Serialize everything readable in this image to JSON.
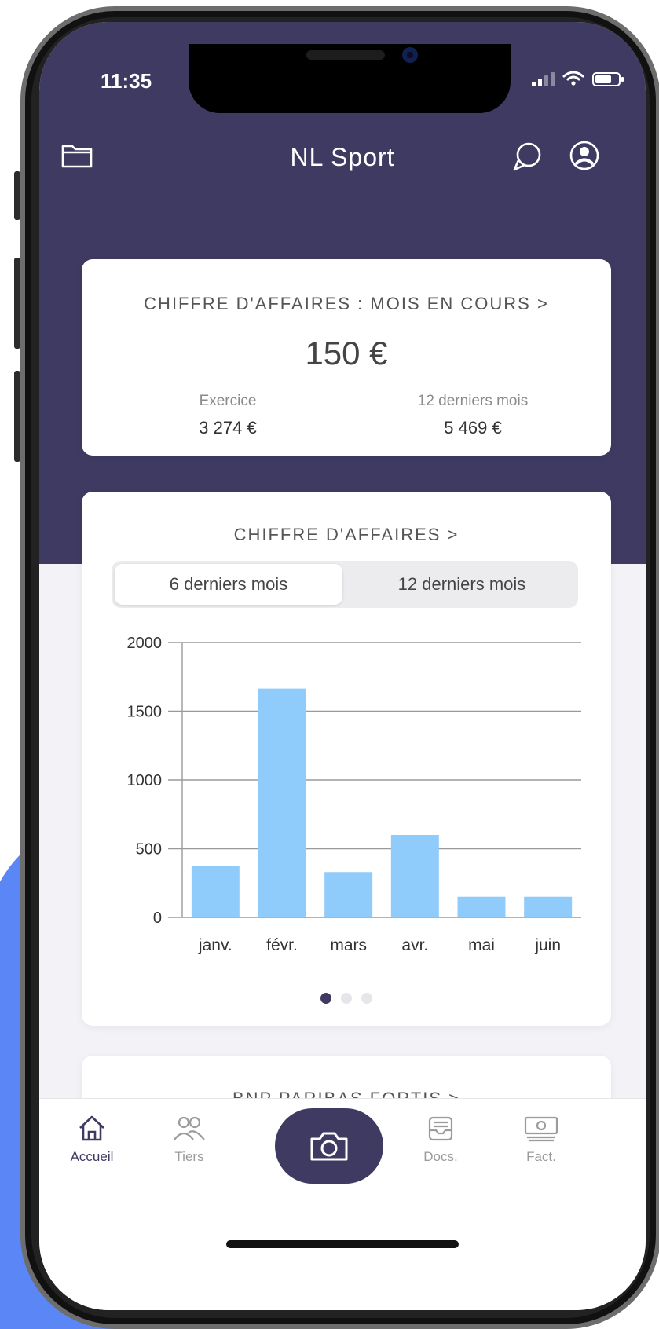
{
  "status_bar": {
    "time": "11:35"
  },
  "header": {
    "title": "NL Sport"
  },
  "revenue_card": {
    "title": "CHIFFRE D'AFFAIRES : MOIS EN COURS >",
    "amount": "150 €",
    "left_label": "Exercice",
    "left_value": "3 274 €",
    "right_label": "12 derniers mois",
    "right_value": "5 469 €"
  },
  "chart_card": {
    "title": "CHIFFRE D'AFFAIRES >",
    "segments": [
      "6 derniers mois",
      "12 derniers mois"
    ],
    "selected_segment": "6 derniers mois",
    "page_indicator": {
      "count": 3,
      "active": 1
    }
  },
  "bank_card": {
    "title": "BNP PARIBAS FORTIS >"
  },
  "tabbar": {
    "items": [
      {
        "label": "Accueil",
        "icon": "home-icon",
        "active": true
      },
      {
        "label": "Tiers",
        "icon": "people-icon",
        "active": false
      },
      {
        "label": "",
        "icon": "camera-icon",
        "active": false
      },
      {
        "label": "Docs.",
        "icon": "inbox-icon",
        "active": false
      },
      {
        "label": "Fact.",
        "icon": "banknote-icon",
        "active": false
      }
    ]
  },
  "colors": {
    "brand": "#3f3a61",
    "bar": "#8fcbfb",
    "accent_bg": "#5b86f5"
  },
  "chart_data": {
    "type": "bar",
    "categories": [
      "janv.",
      "févr.",
      "mars",
      "avr.",
      "mai",
      "juin"
    ],
    "values": [
      375,
      1665,
      330,
      600,
      150,
      150
    ],
    "yticks": [
      0,
      500,
      1000,
      1500,
      2000
    ],
    "ylim": [
      0,
      2000
    ],
    "grid": true
  }
}
